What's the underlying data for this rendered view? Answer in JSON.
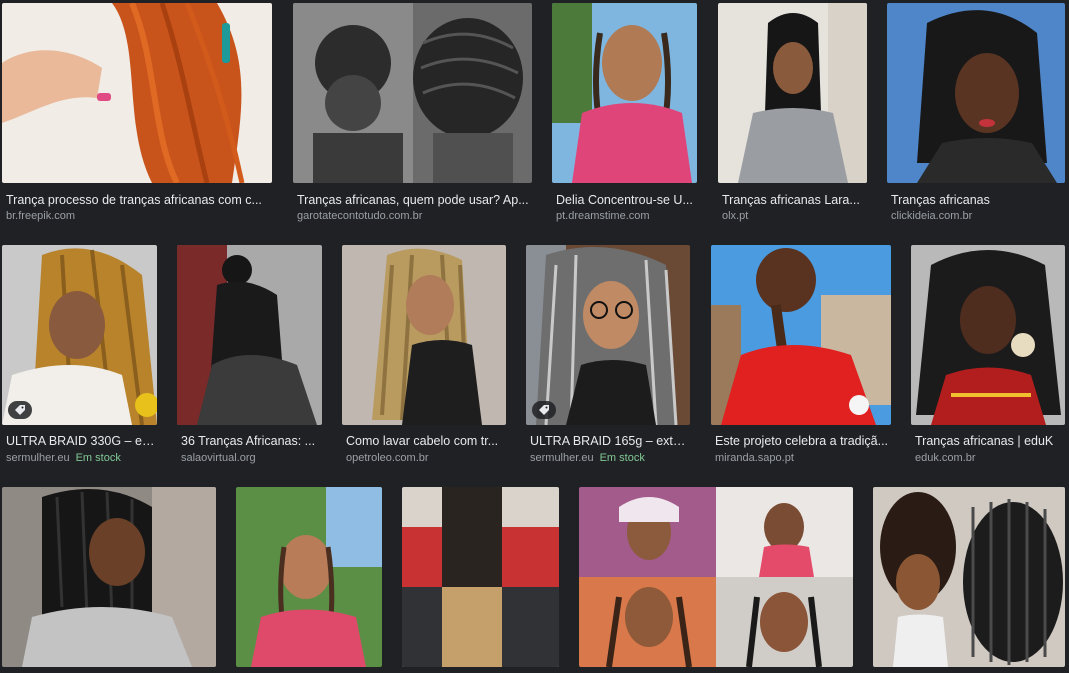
{
  "results": [
    {
      "title": "Trança processo de tranças africanas com c...",
      "source": "br.freepik.com",
      "stock": "",
      "tag": false
    },
    {
      "title": "Tranças africanas, quem pode usar? Ap...",
      "source": "garotatecontotudo.com.br",
      "stock": "",
      "tag": false
    },
    {
      "title": "Delia Concentrou-se U...",
      "source": "pt.dreamstime.com",
      "stock": "",
      "tag": false
    },
    {
      "title": "Tranças africanas Lara...",
      "source": "olx.pt",
      "stock": "",
      "tag": false
    },
    {
      "title": "Tranças africanas",
      "source": "clickideia.com.br",
      "stock": "",
      "tag": false
    },
    {
      "title": "ULTRA BRAID 330G – ext...",
      "source": "sermulher.eu",
      "stock": "Em stock",
      "tag": true
    },
    {
      "title": "36 Tranças Africanas: ...",
      "source": "salaovirtual.org",
      "stock": "",
      "tag": false
    },
    {
      "title": "Como lavar cabelo com tr...",
      "source": "opetroleo.com.br",
      "stock": "",
      "tag": false
    },
    {
      "title": "ULTRA BRAID 165g – exten...",
      "source": "sermulher.eu",
      "stock": "Em stock",
      "tag": true
    },
    {
      "title": "Este projeto celebra a tradiçã...",
      "source": "miranda.sapo.pt",
      "stock": "",
      "tag": false
    },
    {
      "title": "Tranças africanas | eduK",
      "source": "eduk.com.br",
      "stock": "",
      "tag": false
    },
    {
      "title": "",
      "source": "",
      "stock": "",
      "tag": false
    },
    {
      "title": "",
      "source": "",
      "stock": "",
      "tag": false
    },
    {
      "title": "",
      "source": "",
      "stock": "",
      "tag": false
    },
    {
      "title": "",
      "source": "",
      "stock": "",
      "tag": false
    },
    {
      "title": "",
      "source": "",
      "stock": "",
      "tag": false
    }
  ],
  "palette": {
    "background": "#202124",
    "caption": "#e8eaed",
    "source": "#9aa0a6",
    "stock": "#81c995"
  }
}
